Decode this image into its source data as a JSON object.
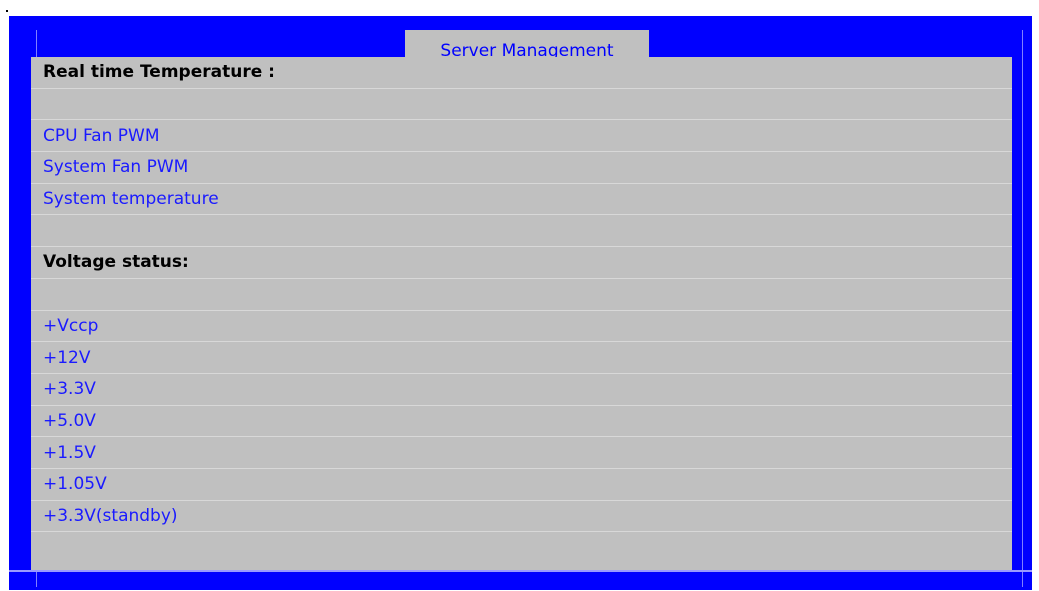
{
  "window": {
    "title": "Server Management"
  },
  "colors": {
    "frame": "#0000ff",
    "panel": "#c0c0c0",
    "item_text": "#1a1aff",
    "heading_text": "#000000"
  },
  "rows": [
    {
      "kind": "head",
      "label": "Real time Temperature :"
    },
    {
      "kind": "blank",
      "label": ""
    },
    {
      "kind": "item",
      "label": "CPU Fan PWM"
    },
    {
      "kind": "item",
      "label": "System Fan PWM"
    },
    {
      "kind": "item",
      "label": "System temperature"
    },
    {
      "kind": "blank",
      "label": ""
    },
    {
      "kind": "head",
      "label": "Voltage status:"
    },
    {
      "kind": "blank",
      "label": ""
    },
    {
      "kind": "item",
      "label": "+Vccp"
    },
    {
      "kind": "item",
      "label": "+12V"
    },
    {
      "kind": "item",
      "label": "+3.3V"
    },
    {
      "kind": "item",
      "label": "+5.0V"
    },
    {
      "kind": "item",
      "label": "+1.5V"
    },
    {
      "kind": "item",
      "label": "+1.05V"
    },
    {
      "kind": "item",
      "label": "+3.3V(standby)"
    }
  ]
}
